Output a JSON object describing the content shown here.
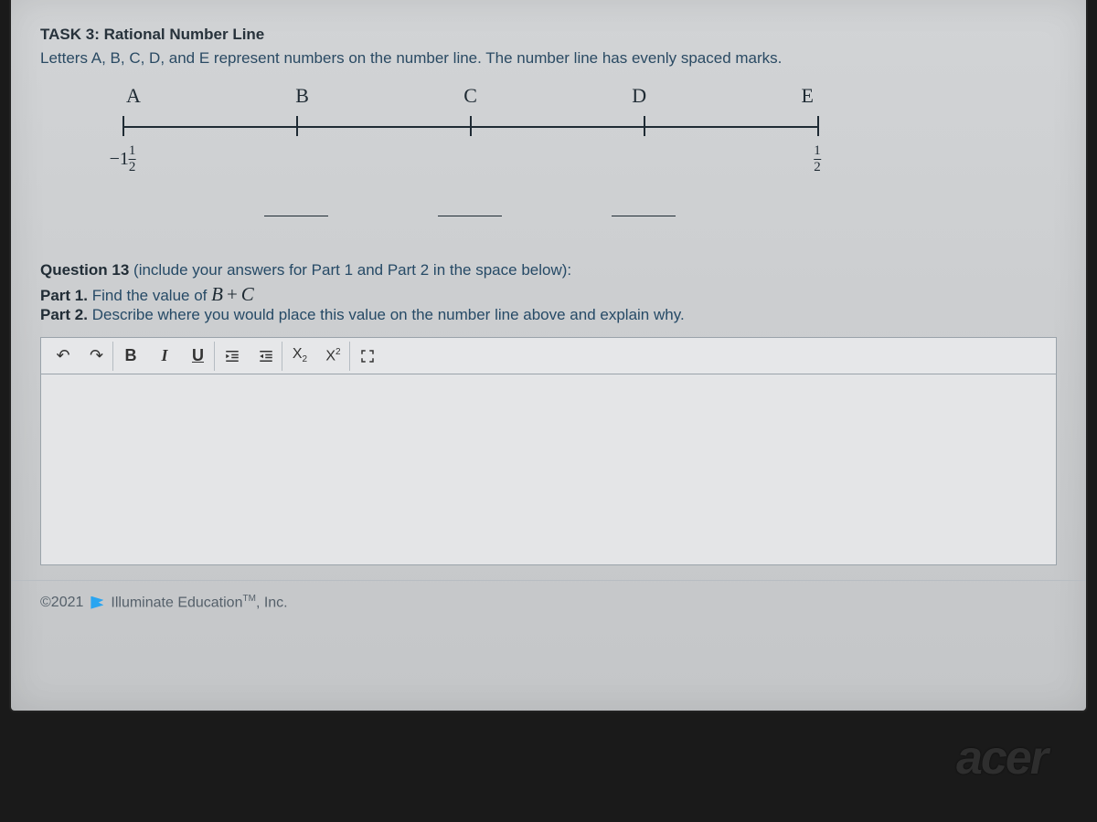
{
  "task": {
    "title": "TASK 3: Rational Number Line",
    "description": "Letters A, B, C, D, and E represent numbers on the number line. The number line has evenly spaced marks."
  },
  "number_line": {
    "letters": [
      "A",
      "B",
      "C",
      "D",
      "E"
    ],
    "label_A": {
      "neg_whole": "−1",
      "num": "1",
      "den": "2"
    },
    "label_E": {
      "num": "1",
      "den": "2"
    },
    "blank_count": 3
  },
  "question": {
    "header_prefix": "Question 13",
    "header_rest": " (include your answers for Part 1 and Part 2 in the space below):",
    "part1_label": "Part 1.",
    "part1_prefix": " Find the value of ",
    "part1_math_lhs": "B",
    "part1_math_op": "+",
    "part1_math_rhs": "C",
    "part2_label": "Part 2.",
    "part2_text": " Describe where you would place this value on the number line above and explain why."
  },
  "toolbar": {
    "undo": "↶",
    "redo": "↷",
    "bold": "B",
    "italic": "I",
    "underline": "U",
    "indent": "⇥",
    "outdent": "⇤",
    "sub_base": "X",
    "sub_sub": "2",
    "sup_base": "X",
    "sup_sup": "2",
    "expand": "⤢"
  },
  "footer": {
    "copyright": "©2021",
    "company": "Illuminate Education",
    "tm": "TM",
    "suffix": ", Inc."
  },
  "device_brand": "acer"
}
